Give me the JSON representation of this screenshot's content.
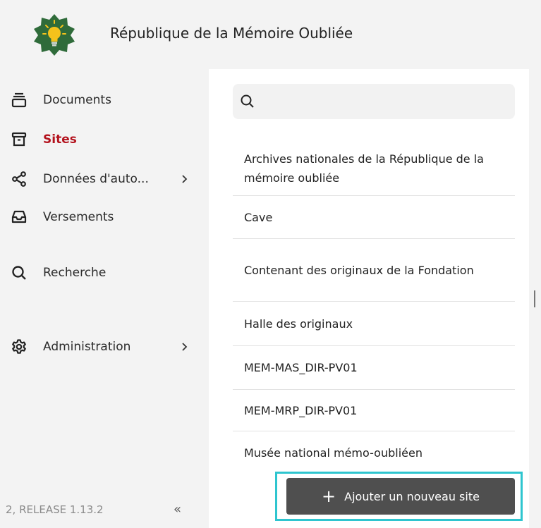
{
  "header": {
    "title": "République de la Mémoire Oubliée"
  },
  "sidebar": {
    "items": [
      {
        "label": "Documents",
        "icon": "stacked-documents-icon",
        "active": false
      },
      {
        "label": "Sites",
        "icon": "archive-box-icon",
        "active": true
      },
      {
        "label": "Données d'auto...",
        "icon": "share-nodes-icon",
        "active": false,
        "expandable": true
      },
      {
        "label": "Versements",
        "icon": "inbox-tray-icon",
        "active": false
      },
      {
        "label": "Recherche",
        "icon": "search-icon",
        "active": false
      },
      {
        "label": "Administration",
        "icon": "gear-icon",
        "active": false,
        "expandable": true
      }
    ],
    "release": "2, RELEASE 1.13.2",
    "collapse_glyph": "«"
  },
  "search": {
    "placeholder": "",
    "value": ""
  },
  "sites": [
    "Archives nationales de la République de la mémoire oubliée",
    "Cave",
    "Contenant des originaux de la Fondation",
    "Halle des originaux",
    "MEM-MAS_DIR-PV01",
    "MEM-MRP_DIR-PV01",
    "Musée national mémo-oubliéen"
  ],
  "actions": {
    "add_site_label": "Ajouter un nouveau site",
    "add_site_glyph": "+"
  },
  "colors": {
    "active": "#b3121d",
    "highlight_border": "#2ec5cf",
    "button_bg": "#4f4f4f",
    "logo_green": "#2f6b3a",
    "bulb_yellow": "#f4c21b"
  }
}
